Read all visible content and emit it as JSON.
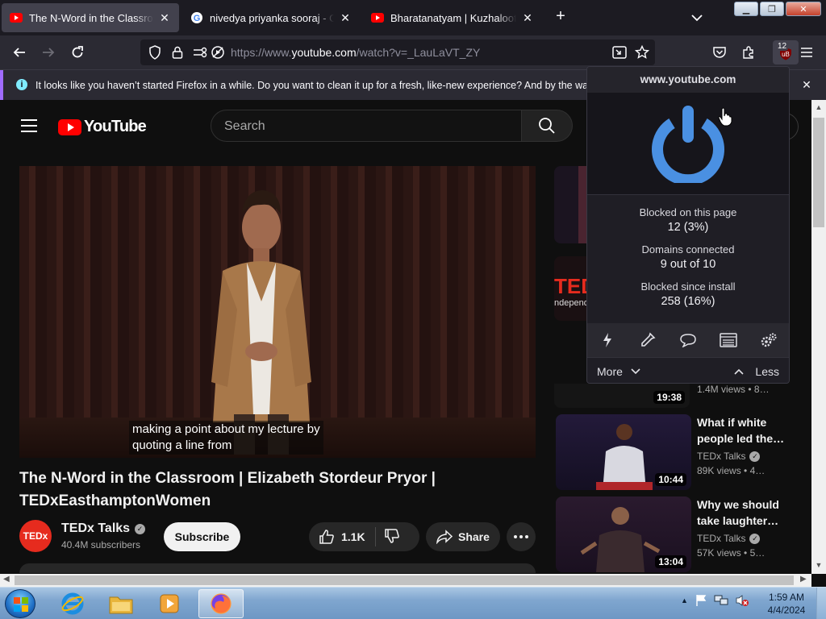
{
  "browser": {
    "tabs": [
      {
        "title": "The N-Word in the Classroom |",
        "favicon": "youtube-icon",
        "active": true
      },
      {
        "title": "nivedya priyanka sooraj - Google",
        "favicon": "google-icon",
        "active": false
      },
      {
        "title": "Bharatanatyam | Kuzhaloothi m",
        "favicon": "youtube-icon",
        "active": false
      }
    ],
    "new_tab_label": "+",
    "url_dim": "https://www.",
    "url_host": "youtube.com",
    "url_path": "/watch?v=_LauLaVT_ZY",
    "ublock_badge": "12",
    "notification": "It looks like you haven’t started Firefox in a while. Do you want to clean it up for a fresh, like-new experience? And by the way, welc"
  },
  "youtube": {
    "logo_text": "YouTube",
    "search_placeholder": "Search",
    "caption_lines": [
      "making a point about my lecture by",
      "quoting a line from"
    ],
    "video_title": "The N-Word in the Classroom | Elizabeth Stordeur Pryor | TEDxEasthamptonWomen",
    "channel": {
      "avatar_text": "TEDx",
      "name": "TEDx Talks",
      "subscribers": "40.4M subscribers"
    },
    "subscribe_label": "Subscribe",
    "likes": "1.1K",
    "share_label": "Share",
    "recommendations": [
      {
        "duration": "19:38",
        "views": "1.4M views",
        "age": "• 8…"
      },
      {
        "title": "What if white people led the…",
        "channel": "TEDx Talks",
        "views": "89K views",
        "age": "• 4…",
        "duration": "10:44"
      },
      {
        "title": "Why we should take laughter…",
        "channel": "TEDx Talks",
        "views": "57K views",
        "age": "• 5…",
        "duration": "13:04"
      }
    ],
    "partial_thumb_text": [
      "TED",
      "ndepende"
    ]
  },
  "ublock": {
    "hostname": "www.youtube.com",
    "stats": [
      {
        "label": "Blocked on this page",
        "value": "12 (3%)"
      },
      {
        "label": "Domains connected",
        "value": "9 out of 10"
      },
      {
        "label": "Blocked since install",
        "value": "258 (16%)"
      }
    ],
    "more_label": "More",
    "less_label": "Less",
    "accent_color": "#4a90e2"
  },
  "taskbar": {
    "time": "1:59 AM",
    "date": "4/4/2024"
  },
  "colors": {
    "youtube_red": "#ff0000",
    "youtube_bg": "#0f0f0f",
    "firefox_toolbar": "#2b2a33"
  }
}
